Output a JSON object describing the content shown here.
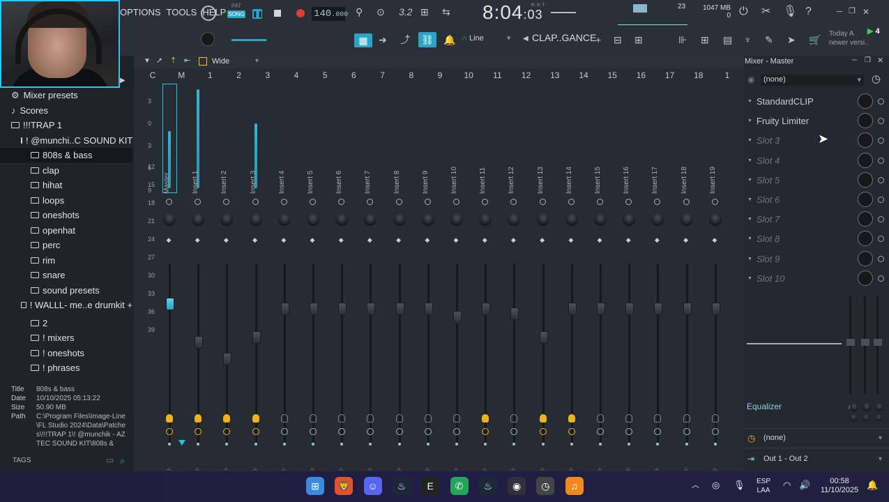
{
  "menu": {
    "options": "OPTIONS",
    "tools": "TOOLS",
    "help": "HELP"
  },
  "transport": {
    "pat": "PAT",
    "song": "SONG",
    "tempo_int": "140",
    "tempo_frac": ".000",
    "time_main": "8:04",
    "time_sub": ":03",
    "rst": "R:S:T"
  },
  "monitor": {
    "cpu": "23",
    "memory": "1047 MB",
    "polyphony": "0"
  },
  "toolbar": {
    "snap": "Line",
    "pattern": "CLAP..GANCE",
    "today_label": "Today",
    "today_line2": "A",
    "news": "newer versi..",
    "badge": "4"
  },
  "browser": {
    "items": [
      {
        "label": "Mixer presets",
        "indent": 1,
        "icon": "gear-icon"
      },
      {
        "label": "Scores",
        "indent": 1,
        "icon": "note-icon"
      },
      {
        "label": "!!!TRAP 1",
        "indent": 1,
        "icon": "folder-icon"
      },
      {
        "label": "! @munchi..C SOUND KIT",
        "indent": 2,
        "icon": "folder-icon"
      },
      {
        "label": "808s & bass",
        "indent": 3,
        "icon": "folder-icon",
        "selected": true
      },
      {
        "label": "clap",
        "indent": 3,
        "icon": "folder-icon"
      },
      {
        "label": "hihat",
        "indent": 3,
        "icon": "folder-icon"
      },
      {
        "label": "loops",
        "indent": 3,
        "icon": "folder-icon"
      },
      {
        "label": "oneshots",
        "indent": 3,
        "icon": "folder-icon"
      },
      {
        "label": "openhat",
        "indent": 3,
        "icon": "folder-icon"
      },
      {
        "label": "perc",
        "indent": 3,
        "icon": "folder-icon"
      },
      {
        "label": "rim",
        "indent": 3,
        "icon": "folder-icon"
      },
      {
        "label": "snare",
        "indent": 3,
        "icon": "folder-icon"
      },
      {
        "label": "sound presets",
        "indent": 3,
        "icon": "folder-icon"
      },
      {
        "label": "! WALLL- me..e drumkit +",
        "indent": 2,
        "icon": "folder-icon"
      },
      {
        "label": "2",
        "indent": 3,
        "icon": "folder-icon"
      },
      {
        "label": "! mixers",
        "indent": 3,
        "icon": "folder-icon"
      },
      {
        "label": "! oneshots",
        "indent": 3,
        "icon": "folder-icon"
      },
      {
        "label": "! phrases",
        "indent": 3,
        "icon": "folder-icon"
      }
    ],
    "info": {
      "title_label": "Title",
      "title": "808s & bass",
      "date_label": "Date",
      "date": "10/10/2025 05:13:22",
      "size_label": "Size",
      "size": "50.90 MB",
      "path_label": "Path",
      "path": "C:\\Program Files\\Image-Line\\FL Studio 2024\\Data\\Patches\\!!!TRAP 1\\! @munchik - AZTEC SOUND KIT\\808s &"
    },
    "tags": "TAGS"
  },
  "mixer": {
    "stereo_mode": "Wide",
    "channel_numbers": [
      "C",
      "M",
      "1",
      "2",
      "3",
      "4",
      "5",
      "6",
      "7",
      "8",
      "9",
      "10",
      "11",
      "12",
      "13",
      "14",
      "15",
      "16",
      "17",
      "18",
      "1"
    ],
    "db_scale": [
      "3",
      "0",
      "3",
      "6",
      "9",
      "12",
      "15",
      "18",
      "21",
      "24",
      "27",
      "30",
      "33",
      "36",
      "39"
    ],
    "strips": [
      {
        "name": "Master",
        "level": 0.55,
        "fader": 0.78,
        "active": true
      },
      {
        "name": "Insert 1",
        "level": 0.95,
        "fader": 0.55,
        "active": true
      },
      {
        "name": "Insert 2",
        "level": 0,
        "fader": 0.45,
        "active": true
      },
      {
        "name": "Insert 3",
        "level": 0.62,
        "fader": 0.58,
        "active": true
      },
      {
        "name": "Insert 4",
        "level": 0,
        "fader": 0.75,
        "active": false
      },
      {
        "name": "Insert 5",
        "level": 0,
        "fader": 0.75,
        "active": false
      },
      {
        "name": "Insert 6",
        "level": 0,
        "fader": 0.75,
        "active": false
      },
      {
        "name": "Insert 7",
        "level": 0,
        "fader": 0.75,
        "active": false
      },
      {
        "name": "Insert 8",
        "level": 0,
        "fader": 0.75,
        "active": false
      },
      {
        "name": "Insert 9",
        "level": 0,
        "fader": 0.75,
        "active": false
      },
      {
        "name": "Insert 10",
        "level": 0,
        "fader": 0.7,
        "active": false
      },
      {
        "name": "Insert 11",
        "level": 0,
        "fader": 0.75,
        "active": true
      },
      {
        "name": "Insert 12",
        "level": 0,
        "fader": 0.72,
        "active": false
      },
      {
        "name": "Insert 13",
        "level": 0,
        "fader": 0.58,
        "active": true
      },
      {
        "name": "Insert 14",
        "level": 0,
        "fader": 0.75,
        "active": true
      },
      {
        "name": "Insert 15",
        "level": 0,
        "fader": 0.75,
        "active": false
      },
      {
        "name": "Insert 16",
        "level": 0,
        "fader": 0.75,
        "active": false
      },
      {
        "name": "Insert 17",
        "level": 0,
        "fader": 0.75,
        "active": false
      },
      {
        "name": "Insert 18",
        "level": 0,
        "fader": 0.75,
        "active": false
      },
      {
        "name": "Insert 19",
        "level": 0,
        "fader": 0.75,
        "active": false
      }
    ]
  },
  "master_panel": {
    "title": "Mixer - Master",
    "input": "(none)",
    "slots": [
      {
        "label": "StandardCLIP",
        "empty": false
      },
      {
        "label": "Fruity Limiter",
        "empty": false
      },
      {
        "label": "Slot 3",
        "empty": true
      },
      {
        "label": "Slot 4",
        "empty": true
      },
      {
        "label": "Slot 5",
        "empty": true
      },
      {
        "label": "Slot 6",
        "empty": true
      },
      {
        "label": "Slot 7",
        "empty": true
      },
      {
        "label": "Slot 8",
        "empty": true
      },
      {
        "label": "Slot 9",
        "empty": true
      },
      {
        "label": "Slot 10",
        "empty": true
      }
    ],
    "equalizer": "Equalizer",
    "output_none": "(none)",
    "output": "Out 1 - Out 2"
  },
  "taskbar": {
    "apps": [
      "start-icon",
      "brave-icon",
      "discord-icon",
      "steam-icon",
      "epic-games-icon",
      "whatsapp-icon",
      "steam-alt-icon",
      "obs-icon",
      "clock-app-icon",
      "fl-studio-icon"
    ],
    "language": "ESP",
    "layout": "LAA",
    "time": "00:58",
    "date": "11/10/2025"
  },
  "colors": {
    "accent": "#2fc0e8",
    "meter": "#36c4e6",
    "active_bulb": "#f0b020",
    "webcam_border": "#24c8ff"
  }
}
